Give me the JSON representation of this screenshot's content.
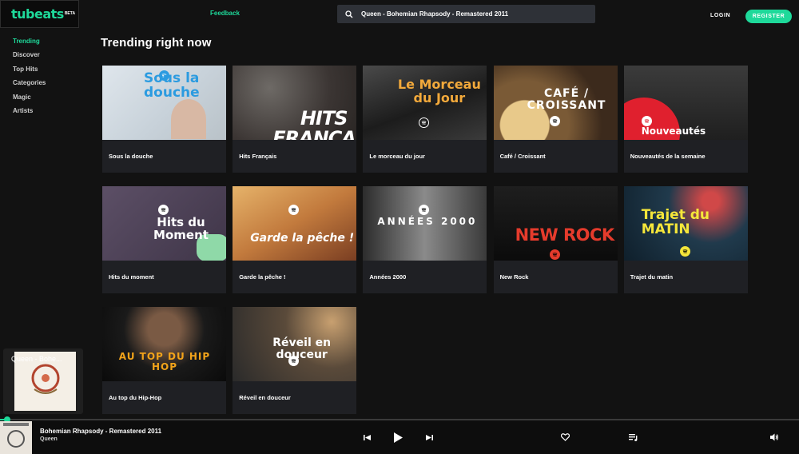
{
  "app": {
    "logo": "tubeats",
    "logo_badge": "BETA",
    "feedback": "Feedback",
    "search_value": "Queen - Bohemian Rhapsody - Remastered 2011",
    "login": "LOGIN",
    "register": "REGISTER",
    "accent": "#1ed99a"
  },
  "sidebar": {
    "items": [
      {
        "label": "Trending",
        "active": true
      },
      {
        "label": "Discover",
        "active": false
      },
      {
        "label": "Top Hits",
        "active": false
      },
      {
        "label": "Categories",
        "active": false
      },
      {
        "label": "Magic",
        "active": false
      },
      {
        "label": "Artists",
        "active": false
      }
    ]
  },
  "main": {
    "title": "Trending right now",
    "playlists": [
      {
        "label": "Sous la douche",
        "cover": "Sous la douche"
      },
      {
        "label": "Hits Français",
        "cover": "HITS FRANCAIS"
      },
      {
        "label": "Le morceau du jour",
        "cover": "Le Morceau du Jour"
      },
      {
        "label": "Café / Croissant",
        "cover": "CAFÉ / CROISSANT"
      },
      {
        "label": "Nouveautés de la semaine",
        "cover": "Nouveautés"
      },
      {
        "label": "Hits du moment",
        "cover": "Hits du Moment"
      },
      {
        "label": "Garde la pêche !",
        "cover": "Garde la pêche !"
      },
      {
        "label": "Années 2000",
        "cover": "ANNÉES 2000"
      },
      {
        "label": "New Rock",
        "cover": "NEW ROCK"
      },
      {
        "label": "Trajet du matin",
        "cover": "Trajet du MATIN"
      },
      {
        "label": "Au top du Hip-Hop",
        "cover": "AU TOP DU HIP HOP"
      },
      {
        "label": "Réveil en douceur",
        "cover": "Réveil en douceur"
      }
    ]
  },
  "mini_player": {
    "title": "Queen - Bohe..."
  },
  "player": {
    "track_title": "Bohemian Rhapsody - Remastered 2011",
    "artist": "Queen",
    "progress": 0.01
  }
}
